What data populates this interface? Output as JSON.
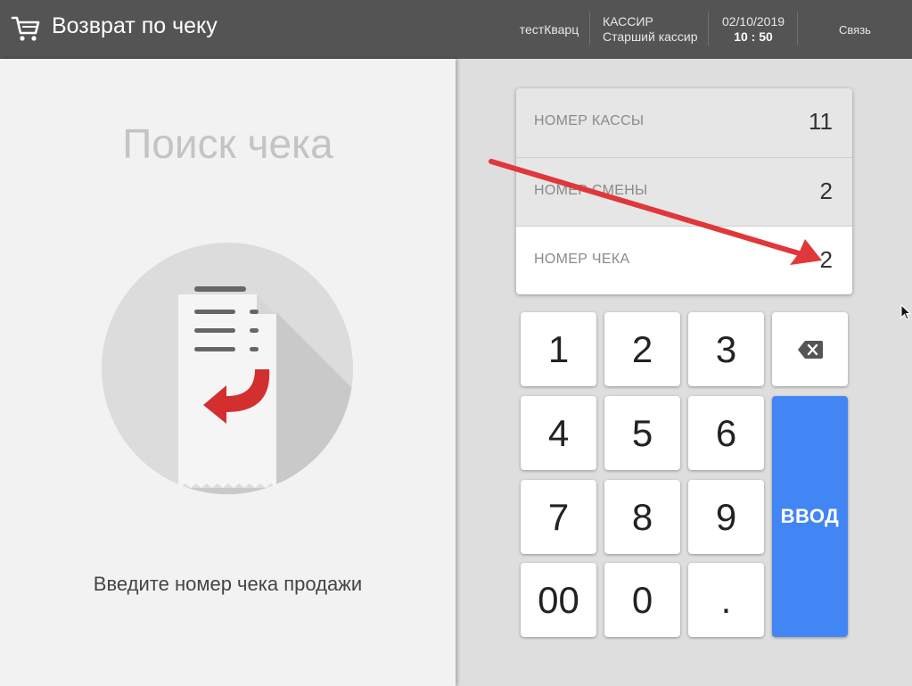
{
  "header": {
    "title": "Возврат по чеку",
    "store": "тестКварц",
    "role_label": "КАССИР",
    "role_name": "Старший кассир",
    "date": "02/10/2019",
    "time": "10 : 50",
    "connection": "Связь"
  },
  "left": {
    "search_title": "Поиск чека",
    "hint": "Введите номер чека продажи",
    "illustration_icon": "receipt-return-icon"
  },
  "fields": [
    {
      "label": "НОМЕР КАССЫ",
      "value": "11",
      "active": false
    },
    {
      "label": "НОМЕР СМЕНЫ",
      "value": "2",
      "active": false
    },
    {
      "label": "НОМЕР ЧЕКА",
      "value": "2",
      "active": true
    }
  ],
  "keypad": {
    "k1": "1",
    "k2": "2",
    "k3": "3",
    "k4": "4",
    "k5": "5",
    "k6": "6",
    "k7": "7",
    "k8": "8",
    "k9": "9",
    "k00": "00",
    "k0": "0",
    "kdot": ".",
    "enter": "ВВОД",
    "backspace_icon": "backspace-icon"
  },
  "colors": {
    "header_bg": "#545454",
    "enter_button": "#4285f4",
    "annotation_arrow": "#e0383a",
    "receipt_arrow": "#d32f2f"
  }
}
